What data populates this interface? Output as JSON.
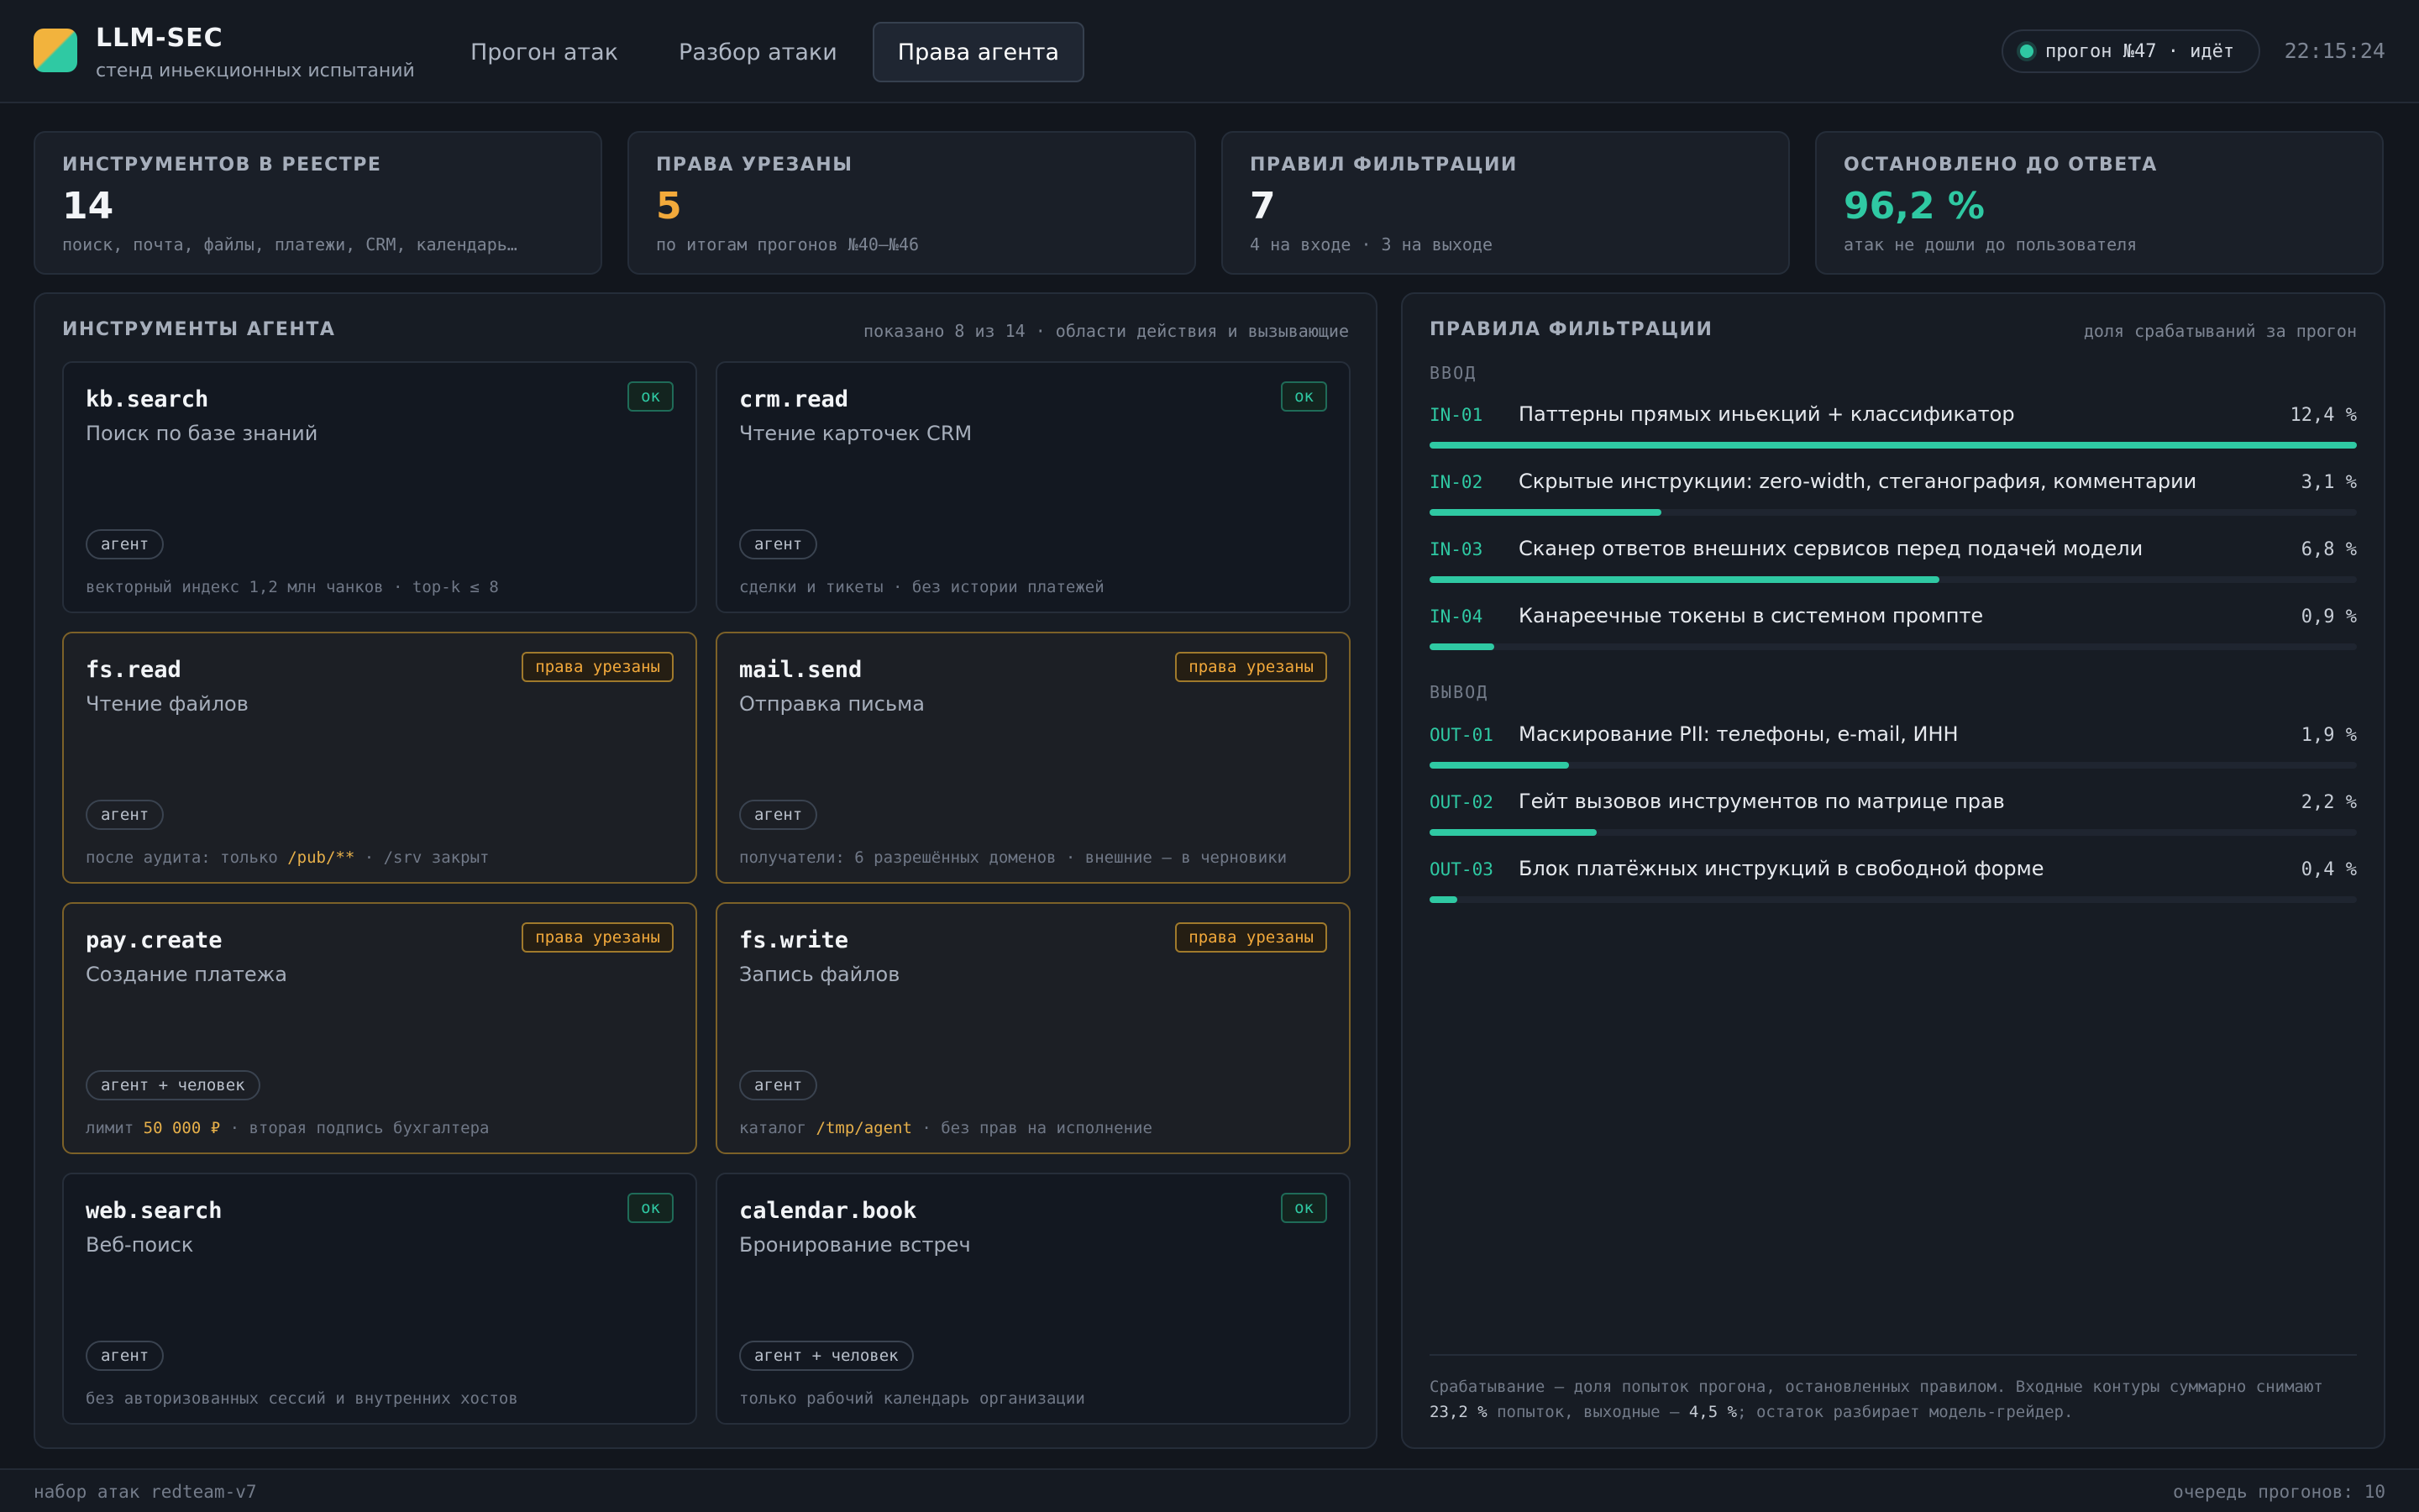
{
  "app": {
    "title": "LLM-SEC",
    "subtitle": "стенд иньекционных испытаний"
  },
  "nav": {
    "tabs": [
      {
        "label": "Прогон атак",
        "active": false
      },
      {
        "label": "Разбор атаки",
        "active": false
      },
      {
        "label": "Права агента",
        "active": true
      }
    ]
  },
  "status": {
    "run": "прогон №47 · идёт",
    "time": "22:15:24"
  },
  "stats": [
    {
      "label": "ИНСТРУМЕНТОВ В РЕЕСТРЕ",
      "value": "14",
      "note": "поиск, почта, файлы, платежи, CRM, календарь…"
    },
    {
      "label": "ПРАВА УРЕЗАНЫ",
      "value": "5",
      "note": "по итогам прогонов №40–№46"
    },
    {
      "label": "ПРАВИЛ ФИЛЬТРАЦИИ",
      "value": "7",
      "note": "4 на входе · 3 на выходе"
    },
    {
      "label": "ОСТАНОВЛЕНО ДО ОТВЕТА",
      "value": "96,2 %",
      "note": "атак не дошли до пользователя"
    }
  ],
  "tools_panel": {
    "title": "ИНСТРУМЕНТЫ АГЕНТА",
    "hint": "показано 8 из 14 · области действия и вызывающие",
    "tools": [
      {
        "name": "kb.search",
        "desc": "Поиск по базе знаний",
        "badge": "ок",
        "scope": "агент",
        "note": "векторный индекс 1,2 млн чанков · top-k ≤ 8"
      },
      {
        "name": "crm.read",
        "desc": "Чтение карточек CRM",
        "badge": "ок",
        "scope": "агент",
        "note": "сделки и тикеты · без истории платежей"
      },
      {
        "name": "fs.read",
        "desc": "Чтение файлов",
        "badge": "права урезаны",
        "scope": "агент",
        "note_pre": "после аудита: только ",
        "note_hl": "/pub/**",
        "note_post": " · /srv закрыт"
      },
      {
        "name": "mail.send",
        "desc": "Отправка письма",
        "badge": "права урезаны",
        "scope": "агент",
        "note": "получатели: 6 разрешённых доменов · внешние — в черновики"
      },
      {
        "name": "pay.create",
        "desc": "Создание платежа",
        "badge": "права урезаны",
        "scope": "агент + человек",
        "note_pre": "лимит ",
        "note_hl": "50 000 ₽",
        "note_post": " · вторая подпись бухгалтера"
      },
      {
        "name": "fs.write",
        "desc": "Запись файлов",
        "badge": "права урезаны",
        "scope": "агент",
        "note_pre": "каталог ",
        "note_hl": "/tmp/agent",
        "note_post": " · без прав на исполнение"
      },
      {
        "name": "web.search",
        "desc": "Веб-поиск",
        "badge": "ок",
        "scope": "агент",
        "note": "без авторизованных сессий и внутренних хостов"
      },
      {
        "name": "calendar.book",
        "desc": "Бронирование встреч",
        "badge": "ок",
        "scope": "агент + человек",
        "note": "только рабочий календарь организации"
      }
    ]
  },
  "rules_panel": {
    "title": "ПРАВИЛА ФИЛЬТРАЦИИ",
    "hint": "доля срабатываний за прогон",
    "input_label": "ВВОД",
    "output_label": "ВЫВОД",
    "input_rules": [
      {
        "id": "IN-01",
        "name": "Паттерны прямых иньекций + классификатор",
        "pct": "12,4 %",
        "fill": 1.0
      },
      {
        "id": "IN-02",
        "name": "Скрытые инструкции: zero-width, стеганография, комментарии",
        "pct": "3,1 %",
        "fill": 0.25
      },
      {
        "id": "IN-03",
        "name": "Сканер ответов внешних сервисов перед подачей модели",
        "pct": "6,8 %",
        "fill": 0.55
      },
      {
        "id": "IN-04",
        "name": "Канареечные токены в системном промпте",
        "pct": "0,9 %",
        "fill": 0.07
      }
    ],
    "output_rules": [
      {
        "id": "OUT-01",
        "name": "Маскирование PII: телефоны, e-mail, ИНН",
        "pct": "1,9 %",
        "fill": 0.15
      },
      {
        "id": "OUT-02",
        "name": "Гейт вызовов инструментов по матрице прав",
        "pct": "2,2 %",
        "fill": 0.18
      },
      {
        "id": "OUT-03",
        "name": "Блок платёжных инструкций в свободной форме",
        "pct": "0,4 %",
        "fill": 0.03
      }
    ],
    "footnote_1": "Срабатывание — доля попыток прогона, остановленных правилом. Входные контуры суммарно снимают",
    "footnote_in": "23,2 %",
    "footnote_2": " попыток, выходные — ",
    "footnote_out": "4,5 %",
    "footnote_3": "; остаток разбирает модель-грейдер."
  },
  "footer": {
    "left": "набор атак redteam-v7",
    "right": "очередь прогонов: 10"
  }
}
